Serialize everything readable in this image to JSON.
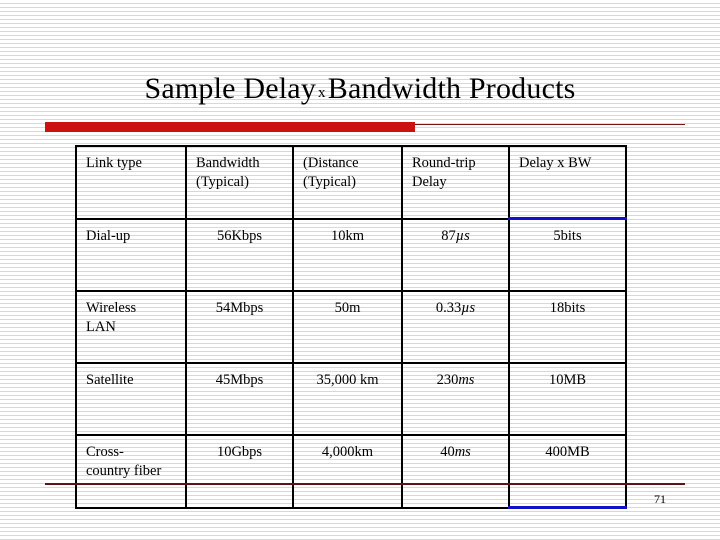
{
  "slide": {
    "title_part1": "Sample Delay",
    "title_symbol": "x",
    "title_part2": "Bandwidth Products",
    "page_number": "71",
    "accent_red": "#cc1111",
    "accent_dark_red": "#5e1216",
    "highlight_blue": "#1111cc"
  },
  "table": {
    "headers": [
      "Link type",
      "Bandwidth (Typical)",
      "(Distance (Typical)",
      "Round-trip Delay",
      "Delay x BW"
    ],
    "headers_lines": [
      [
        "Link type"
      ],
      [
        "Bandwidth",
        "(Typical)"
      ],
      [
        "(Distance",
        "(Typical)"
      ],
      [
        "Round-trip",
        "Delay"
      ],
      [
        "Delay x BW"
      ]
    ],
    "rows": [
      {
        "link_type_lines": [
          "Dial-up"
        ],
        "bandwidth": "56Kbps",
        "distance": "10km",
        "delay_value": "87",
        "delay_unit": "µs",
        "delay_bw": "5bits"
      },
      {
        "link_type_lines": [
          "Wireless",
          "LAN"
        ],
        "bandwidth": "54Mbps",
        "distance": "50m",
        "delay_value": "0.33",
        "delay_unit": "µs",
        "delay_bw": "18bits"
      },
      {
        "link_type_lines": [
          "Satellite"
        ],
        "bandwidth": "45Mbps",
        "distance": "35,000 km",
        "delay_value": "230",
        "delay_unit": "ms",
        "delay_bw": "10MB"
      },
      {
        "link_type_lines": [
          "Cross-",
          "country fiber"
        ],
        "bandwidth": "10Gbps",
        "distance": "4,000km",
        "delay_value": "40",
        "delay_unit": "ms",
        "delay_bw": "400MB"
      }
    ]
  }
}
